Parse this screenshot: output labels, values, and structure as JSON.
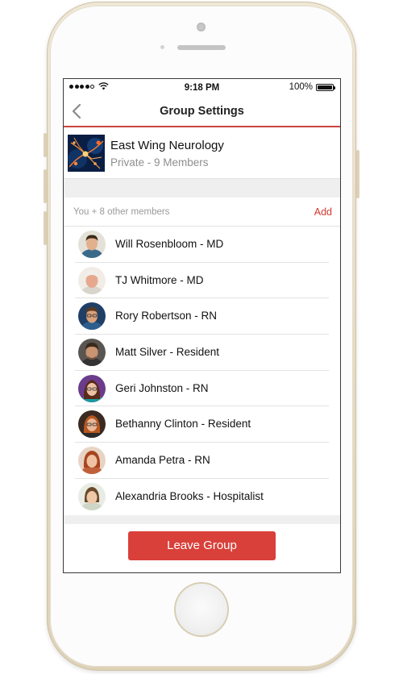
{
  "status_bar": {
    "time": "9:18 PM",
    "battery": "100%",
    "battery_level": 1.0,
    "signal_dots_filled": 4,
    "signal_dots_total": 5
  },
  "nav": {
    "title": "Group Settings",
    "back_icon": "chevron-left-icon"
  },
  "group": {
    "name": "East Wing Neurology",
    "meta": "Private - 9 Members"
  },
  "members_section": {
    "count_label": "You + 8 other members",
    "add_label": "Add"
  },
  "members": [
    {
      "name": "Will Rosenbloom - MD"
    },
    {
      "name": "TJ Whitmore - MD"
    },
    {
      "name": "Rory Robertson - RN"
    },
    {
      "name": "Matt Silver - Resident"
    },
    {
      "name": "Geri Johnston - RN"
    },
    {
      "name": "Bethanny Clinton - Resident"
    },
    {
      "name": "Amanda Petra - RN"
    },
    {
      "name": "Alexandria Brooks - Hospitalist"
    }
  ],
  "footer": {
    "leave_label": "Leave Group"
  },
  "colors": {
    "accent": "#d9403a",
    "link": "#d33a30",
    "phone_gold": "#e6dcc6"
  }
}
